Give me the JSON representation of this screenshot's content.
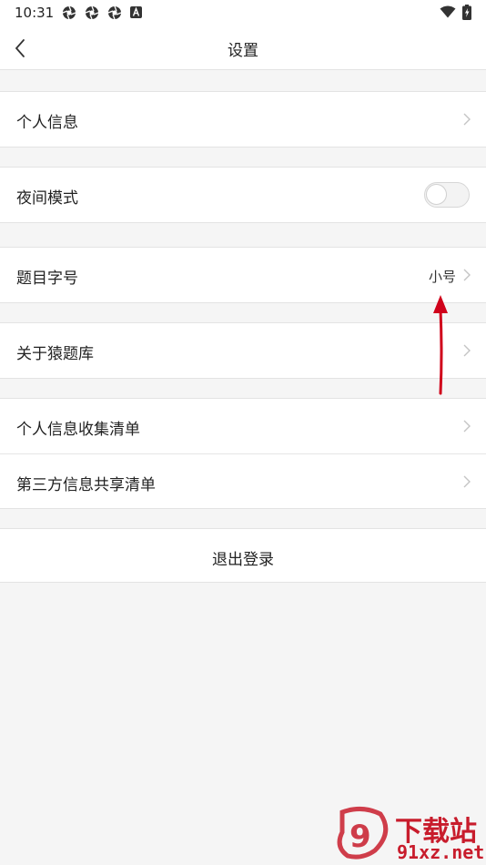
{
  "statusbar": {
    "time": "10:31",
    "icons": [
      "aperture-icon",
      "aperture-icon",
      "aperture-icon",
      "a-badge-icon",
      "wifi-icon",
      "battery-charging-icon"
    ]
  },
  "navbar": {
    "title": "设置",
    "back_icon": "chevron-left-icon"
  },
  "settings": {
    "personal_info": {
      "label": "个人信息"
    },
    "night_mode": {
      "label": "夜间模式",
      "enabled": false
    },
    "font_size": {
      "label": "题目字号",
      "value": "小号"
    },
    "about": {
      "label": "关于猿题库"
    },
    "info_collection": {
      "label": "个人信息收集清单"
    },
    "third_party": {
      "label": "第三方信息共享清单"
    }
  },
  "logout": {
    "label": "退出登录"
  },
  "annotation": {
    "color": "#d0021b"
  },
  "watermark": {
    "brand": "下载站",
    "url": "91xz.net",
    "color": "#c81c2c"
  }
}
